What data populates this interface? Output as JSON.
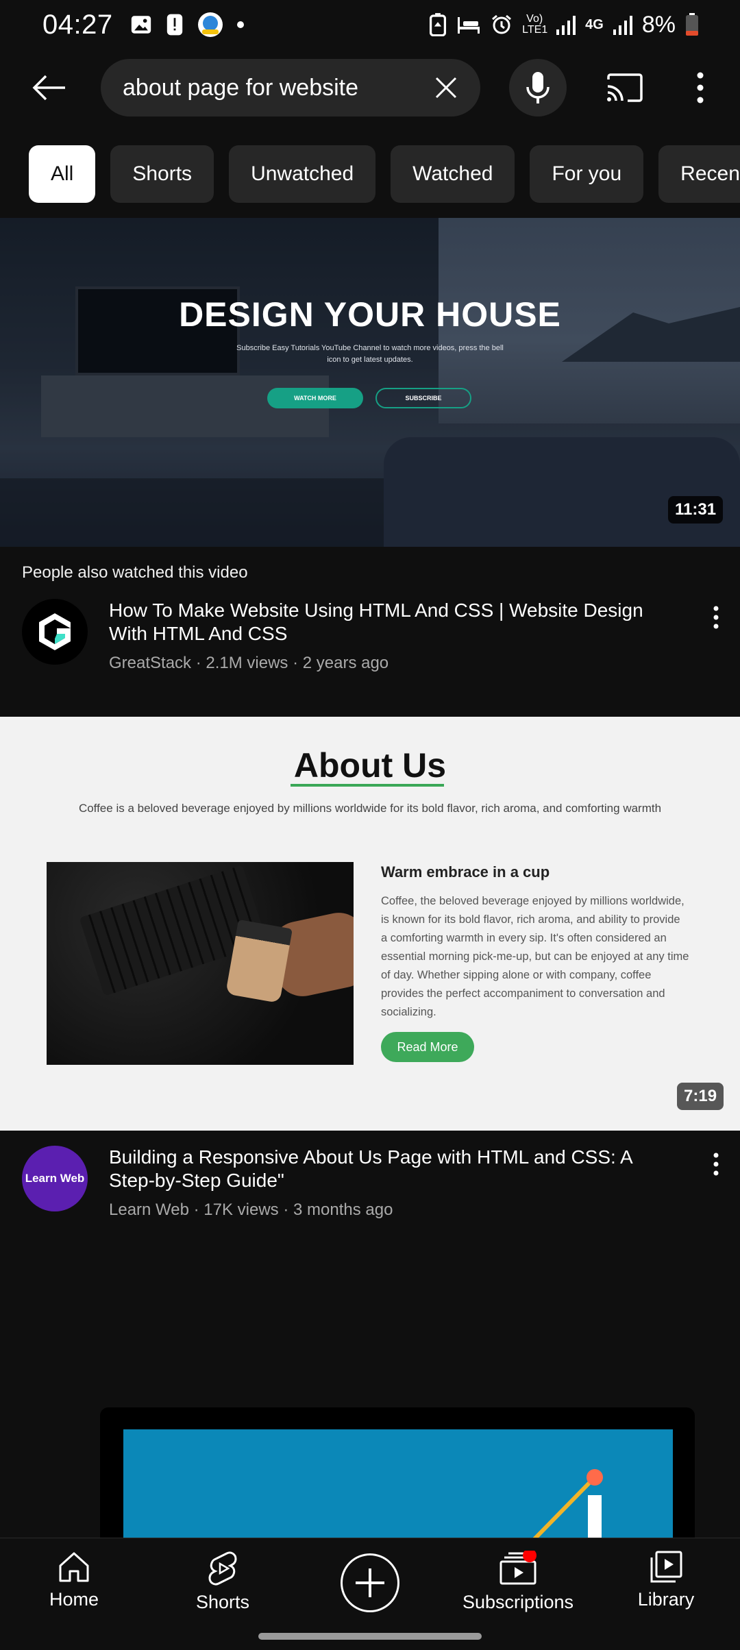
{
  "status_bar": {
    "time": "04:27",
    "network_label": "4G",
    "lte_label": "Vo) LTE1",
    "battery": "8%"
  },
  "search": {
    "query": "about page for website"
  },
  "chips": [
    "All",
    "Shorts",
    "Unwatched",
    "Watched",
    "For you",
    "Recently uploaded"
  ],
  "video1": {
    "thumb_headline": "DESIGN YOUR HOUSE",
    "thumb_subtitle": "Subscribe Easy Tutorials YouTube Channel to watch more videos, press the bell icon to get latest updates.",
    "thumb_btn1": "WATCH MORE",
    "thumb_btn2": "SUBSCRIBE",
    "duration": "11:31",
    "context": "People also watched this video",
    "title": "How To Make Website Using HTML And CSS | Website Design With HTML And CSS",
    "meta": "GreatStack · 2.1M views · 2 years ago"
  },
  "video2": {
    "thumb_title": "About Us",
    "thumb_tagline": "Coffee is a beloved beverage enjoyed by millions worldwide for its bold flavor, rich aroma, and comforting warmth",
    "thumb_heading": "Warm embrace in a cup",
    "thumb_paragraph": "Coffee, the beloved beverage enjoyed by millions worldwide, is known for its bold flavor, rich aroma, and ability to provide a comforting warmth in every sip. It's often considered an essential morning pick-me-up, but can be enjoyed at any time of day. Whether sipping alone or with company, coffee provides the perfect accompaniment to conversation and socializing.",
    "thumb_button": "Read More",
    "duration": "7:19",
    "channel_avatar_text": "Learn Web",
    "title": "Building a Responsive About Us Page with HTML and CSS: A Step-by-Step Guide\"",
    "meta": "Learn Web · 17K views · 3 months ago"
  },
  "bottom_nav": {
    "home": "Home",
    "shorts": "Shorts",
    "subscriptions": "Subscriptions",
    "library": "Library"
  },
  "colors": {
    "background": "#0f0f0f",
    "chip_bg": "#272727",
    "notification_dot": "#ff0000",
    "learnweb_avatar": "#5b1fb0"
  }
}
